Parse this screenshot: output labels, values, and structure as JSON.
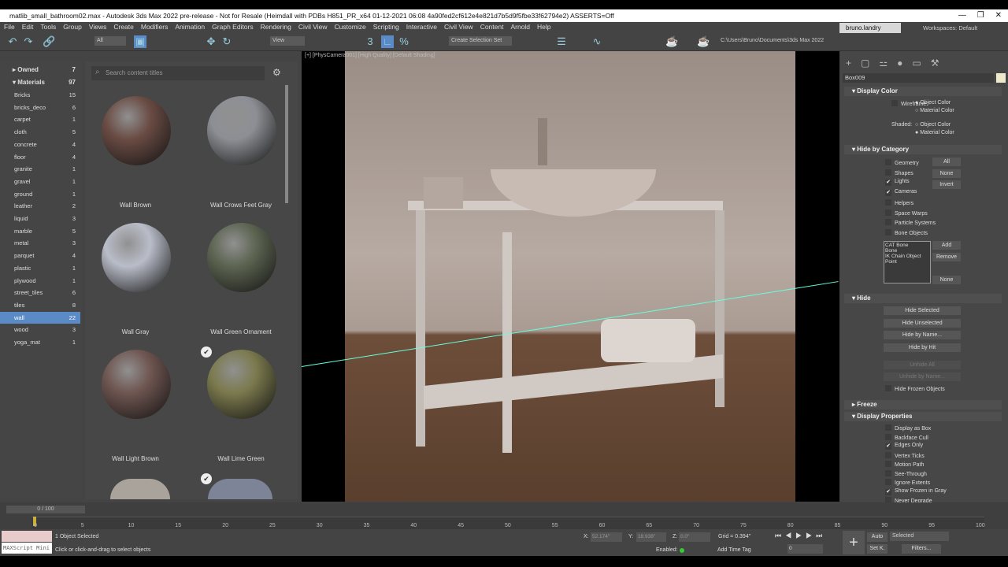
{
  "title": "matlib_small_bathroom02.max - Autodesk 3ds Max 2022 pre-release - Not for Resale (Heimdall with PDBs H851_PR_x64 01-12-2021 06:08 4a90fed2cf612e4e821d7b5d9f5fbe33f62794e2) ASSERTS=Off",
  "menu": [
    "File",
    "Edit",
    "Tools",
    "Group",
    "Views",
    "Create",
    "Modifiers",
    "Animation",
    "Graph Editors",
    "Rendering",
    "Civil View",
    "Customize",
    "Scripting",
    "Interactive",
    "Civil View",
    "Content",
    "Arnold",
    "Help"
  ],
  "toolbar": {
    "filter": "All",
    "refcoord": "View",
    "selset": "Create Selection Set",
    "path": "C:\\Users\\Bruno\\Documents\\3ds Max 2022"
  },
  "user": "bruno.landry",
  "workspaces_label": "Workspaces:",
  "workspace": "Default",
  "library": {
    "owned": {
      "label": "Owned",
      "count": "7"
    },
    "materials": {
      "label": "Materials",
      "count": "97"
    },
    "categories": [
      {
        "l": "Bricks",
        "n": "15"
      },
      {
        "l": "bricks_deco",
        "n": "6"
      },
      {
        "l": "carpet",
        "n": "1"
      },
      {
        "l": "cloth",
        "n": "5"
      },
      {
        "l": "concrete",
        "n": "4"
      },
      {
        "l": "floor",
        "n": "4"
      },
      {
        "l": "granite",
        "n": "1"
      },
      {
        "l": "gravel",
        "n": "1"
      },
      {
        "l": "ground",
        "n": "1"
      },
      {
        "l": "leather",
        "n": "2"
      },
      {
        "l": "liquid",
        "n": "3"
      },
      {
        "l": "marble",
        "n": "5"
      },
      {
        "l": "metal",
        "n": "3"
      },
      {
        "l": "parquet",
        "n": "4"
      },
      {
        "l": "plastic",
        "n": "1"
      },
      {
        "l": "plywood",
        "n": "1"
      },
      {
        "l": "street_tiles",
        "n": "6"
      },
      {
        "l": "tiles",
        "n": "8"
      },
      {
        "l": "wall",
        "n": "22"
      },
      {
        "l": "wood",
        "n": "3"
      },
      {
        "l": "yoga_mat",
        "n": "1"
      }
    ],
    "selected": "wall"
  },
  "materials_grid": {
    "search_placeholder": "Search content titles",
    "items": [
      {
        "name": "Wall Brown",
        "color": "#6a4c44"
      },
      {
        "name": "Wall Crows Feet Gray",
        "color": "#8d8f94"
      },
      {
        "name": "Wall Gray",
        "color": "#b9bdc8"
      },
      {
        "name": "Wall Green Ornament",
        "color": "#5d6552"
      },
      {
        "name": "Wall Light Brown",
        "color": "#6f5651"
      },
      {
        "name": "Wall Lime Green",
        "color": "#7b7a4e"
      }
    ]
  },
  "viewport": {
    "label": "[+] [PhysCamera001] [High Quality] [Default Shading]"
  },
  "command_panel": {
    "object_name": "Box009",
    "display_color": {
      "title": "Display Color",
      "wireframe": "Wireframe:",
      "shaded": "Shaded:",
      "object_color": "Object Color",
      "material_color": "Material Color"
    },
    "hide_by_category": {
      "title": "Hide by Category",
      "items": [
        {
          "l": "Geometry",
          "on": false
        },
        {
          "l": "Shapes",
          "on": false
        },
        {
          "l": "Lights",
          "on": true
        },
        {
          "l": "Cameras",
          "on": true
        },
        {
          "l": "Helpers",
          "on": false
        },
        {
          "l": "Space Warps",
          "on": false
        },
        {
          "l": "Particle Systems",
          "on": false
        },
        {
          "l": "Bone Objects",
          "on": false
        }
      ],
      "all": "All",
      "none": "None",
      "invert": "Invert",
      "list": [
        "CAT Bone",
        "Bone",
        "IK Chain Object",
        "Point"
      ],
      "add": "Add",
      "remove": "Remove",
      "none2": "None"
    },
    "hide": {
      "title": "Hide",
      "buttons": [
        "Hide Selected",
        "Hide Unselected",
        "Hide by Name...",
        "Hide by Hit"
      ],
      "disabled": [
        "Unhide All",
        "Unhide by Name..."
      ],
      "frozen": "Hide Frozen Objects"
    },
    "freeze": {
      "title": "Freeze"
    },
    "display_props": {
      "title": "Display Properties",
      "items": [
        {
          "l": "Display as Box",
          "on": false
        },
        {
          "l": "Backface Cull",
          "on": false
        },
        {
          "l": "Edges Only",
          "on": true
        },
        {
          "l": "Vertex Ticks",
          "on": false
        },
        {
          "l": "Motion Path",
          "on": false
        },
        {
          "l": "See-Through",
          "on": false
        },
        {
          "l": "Ignore Extents",
          "on": false
        },
        {
          "l": "Show Frozen in Gray",
          "on": true
        },
        {
          "l": "Never Degrade",
          "on": false
        }
      ]
    }
  },
  "timeline": {
    "frame": "0 / 100",
    "ticks": [
      "0",
      "5",
      "10",
      "15",
      "20",
      "25",
      "30",
      "35",
      "40",
      "45",
      "50",
      "55",
      "60",
      "65",
      "70",
      "75",
      "80",
      "85",
      "90",
      "95",
      "100"
    ]
  },
  "status": {
    "selected": "1 Object Selected",
    "prompt": "Click or click-and-drag to select objects",
    "maxscript": "MAXScript Mini",
    "x": "X:",
    "xv": "52.174\"",
    "y": "Y:",
    "yv": "18.938\"",
    "z": "Z:",
    "zv": "0.0\"",
    "grid": "Grid = 0.394\"",
    "enabled": "Enabled:",
    "add_time_tag": "Add Time Tag",
    "auto": "Auto",
    "setk": "Set K.",
    "key_mode": "Selected",
    "filters": "Filters...",
    "frame": "0"
  }
}
